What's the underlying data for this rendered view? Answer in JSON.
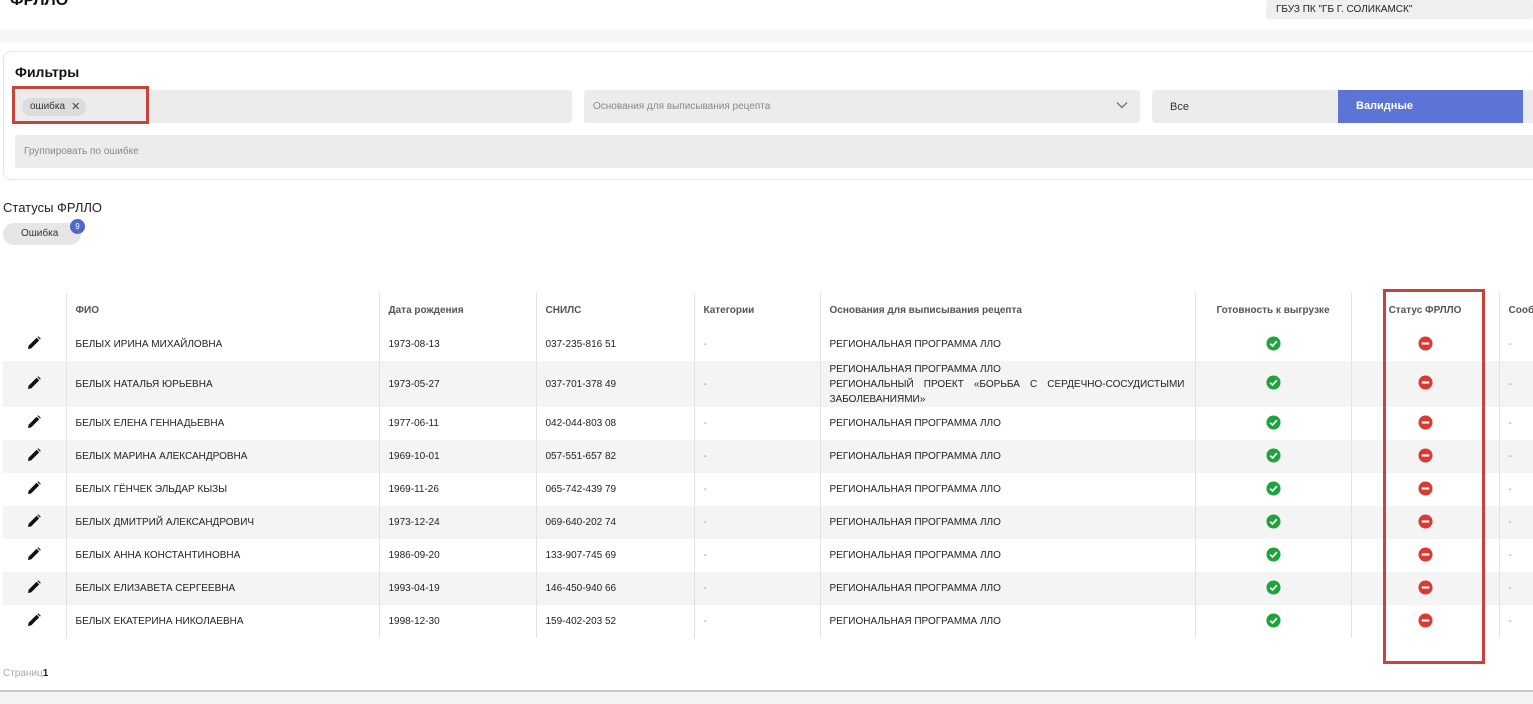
{
  "header": {
    "title": "ФРЛЛО",
    "organization": "ГБУЗ ПК \"ГБ Г. СОЛИКАМСК\""
  },
  "filters": {
    "title": "Фильтры",
    "error_chip": "ошибка",
    "basis_placeholder": "Основания для выписывания рецепта",
    "toggle_all": "Все",
    "toggle_valid": "Валидные",
    "group_placeholder": "Группировать по ошибке"
  },
  "statuses": {
    "title": "Статусы ФРЛЛО",
    "pill_label": "Ошибка",
    "pill_count": "9"
  },
  "table": {
    "columns": [
      "",
      "ФИО",
      "Дата рождения",
      "СНИЛС",
      "Категории",
      "Основания для выписывания рецепта",
      "Готовность к выгрузке",
      "Статус ФРЛЛО",
      "Сооб"
    ],
    "rows": [
      {
        "fio": "БЕЛЫХ ИРИНА МИХАЙЛОВНА",
        "dob": "1973-08-13",
        "snils": "037-235-816 51",
        "category": "-",
        "basis": [
          "РЕГИОНАЛЬНАЯ ПРОГРАММА ЛЛО"
        ],
        "msg": "-"
      },
      {
        "fio": "БЕЛЫХ НАТАЛЬЯ ЮРЬЕВНА",
        "dob": "1973-05-27",
        "snils": "037-701-378 49",
        "category": "-",
        "basis": [
          "РЕГИОНАЛЬНАЯ ПРОГРАММА ЛЛО",
          "РЕГИОНАЛЬНЫЙ ПРОЕКТ «БОРЬБА С СЕРДЕЧНО-СОСУДИСТЫМИ",
          "ЗАБОЛЕВАНИЯМИ»"
        ],
        "msg": "-"
      },
      {
        "fio": "БЕЛЫХ ЕЛЕНА ГЕННАДЬЕВНА",
        "dob": "1977-06-11",
        "snils": "042-044-803 08",
        "category": "-",
        "basis": [
          "РЕГИОНАЛЬНАЯ ПРОГРАММА ЛЛО"
        ],
        "msg": "-"
      },
      {
        "fio": "БЕЛЫХ МАРИНА АЛЕКСАНДРОВНА",
        "dob": "1969-10-01",
        "snils": "057-551-657 82",
        "category": "-",
        "basis": [
          "РЕГИОНАЛЬНАЯ ПРОГРАММА ЛЛО"
        ],
        "msg": "-"
      },
      {
        "fio": "БЕЛЫХ ГЁНЧЕК ЭЛЬДАР КЫЗЫ",
        "dob": "1969-11-26",
        "snils": "065-742-439 79",
        "category": "-",
        "basis": [
          "РЕГИОНАЛЬНАЯ ПРОГРАММА ЛЛО"
        ],
        "msg": "-"
      },
      {
        "fio": "БЕЛЫХ ДМИТРИЙ АЛЕКСАНДРОВИЧ",
        "dob": "1973-12-24",
        "snils": "069-640-202 74",
        "category": "-",
        "basis": [
          "РЕГИОНАЛЬНАЯ ПРОГРАММА ЛЛО"
        ],
        "msg": "-"
      },
      {
        "fio": "БЕЛЫХ АННА КОНСТАНТИНОВНА",
        "dob": "1986-09-20",
        "snils": "133-907-745 69",
        "category": "-",
        "basis": [
          "РЕГИОНАЛЬНАЯ ПРОГРАММА ЛЛО"
        ],
        "msg": "-"
      },
      {
        "fio": "БЕЛЫХ ЕЛИЗАВЕТА СЕРГЕЕВНА",
        "dob": "1993-04-19",
        "snils": "146-450-940 66",
        "category": "-",
        "basis": [
          "РЕГИОНАЛЬНАЯ ПРОГРАММА ЛЛО"
        ],
        "msg": "-"
      },
      {
        "fio": "БЕЛЫХ ЕКАТЕРИНА НИКОЛАЕВНА",
        "dob": "1998-12-30",
        "snils": "159-402-203 52",
        "category": "-",
        "basis": [
          "РЕГИОНАЛЬНАЯ ПРОГРАММА ЛЛО"
        ],
        "msg": "-"
      }
    ]
  },
  "pager": {
    "label": "Страниц",
    "current": "1"
  },
  "colors": {
    "accent": "#5b74d6",
    "ok": "#1fa33b",
    "error": "#d93b34",
    "highlight": "#c9433a"
  },
  "icons": {
    "edit": "pencil-icon",
    "ready": "check-circle-icon",
    "status": "minus-circle-icon",
    "chip_remove": "close-icon",
    "dropdown": "chevron-down-icon"
  }
}
